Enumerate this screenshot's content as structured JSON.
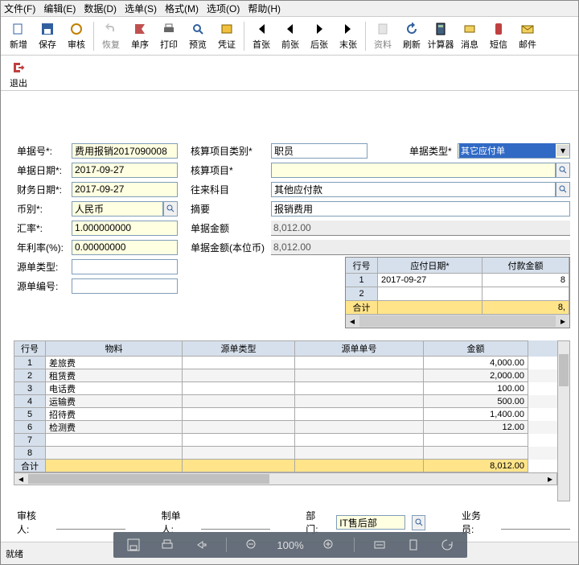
{
  "menu": {
    "file": "文件(F)",
    "edit": "编辑(E)",
    "data": "数据(D)",
    "select": "选单(S)",
    "format": "格式(M)",
    "option": "选项(O)",
    "help": "帮助(H)"
  },
  "toolbar": {
    "new": "新增",
    "save": "保存",
    "review": "审核",
    "restore": "恢复",
    "seq": "单序",
    "print": "打印",
    "preview": "预览",
    "voucher": "凭证",
    "first": "首张",
    "prev": "前张",
    "next": "后张",
    "last": "末张",
    "info": "资料",
    "refresh": "刷新",
    "calc": "计算器",
    "msg": "消息",
    "sms": "短信",
    "mail": "邮件",
    "exit": "退出"
  },
  "labels": {
    "billno": "单据号*:",
    "billdate": "单据日期*:",
    "findate": "财务日期*:",
    "curr": "币别*:",
    "rate": "汇率*:",
    "yearint": "年利率(%):",
    "srctype": "源单类型:",
    "srcno": "源单编号:",
    "acctcat": "核算项目类别*",
    "acctitem": "核算项目*",
    "fromacct": "往来科目",
    "summary": "摘要",
    "docamt": "单据金额",
    "docamtloc": "单据金额(本位币)",
    "doctype": "单据类型*"
  },
  "values": {
    "billno": "费用报销2017090008",
    "billdate": "2017-09-27",
    "findate": "2017-09-27",
    "curr": "人民币",
    "rate": "1.000000000",
    "yearint": "0.00000000",
    "srctype": "",
    "srcno": "",
    "acctcat": "职员",
    "acctitem": "",
    "fromacct": "其他应付款",
    "summary": "报销费用",
    "docamt": "8,012.00",
    "docamtloc": "8,012.00",
    "doctype": "其它应付单"
  },
  "paygrid": {
    "h_row": "行号",
    "h_date": "应付日期*",
    "h_amt": "付款金额",
    "rows": [
      {
        "n": "1",
        "date": "2017-09-27",
        "amt": "8"
      },
      {
        "n": "2",
        "date": "",
        "amt": ""
      }
    ],
    "total_lbl": "合计",
    "total_amt": "8,"
  },
  "detail": {
    "h_row": "行号",
    "h_mat": "物料",
    "h_srctype": "源单类型",
    "h_srcno": "源单单号",
    "h_amt": "金额",
    "rows": [
      {
        "n": "1",
        "mat": "差旅费",
        "srctype": "",
        "srcno": "",
        "amt": "4,000.00"
      },
      {
        "n": "2",
        "mat": "租赁费",
        "srctype": "",
        "srcno": "",
        "amt": "2,000.00"
      },
      {
        "n": "3",
        "mat": "电话费",
        "srctype": "",
        "srcno": "",
        "amt": "100.00"
      },
      {
        "n": "4",
        "mat": "运输费",
        "srctype": "",
        "srcno": "",
        "amt": "500.00"
      },
      {
        "n": "5",
        "mat": "招待费",
        "srctype": "",
        "srcno": "",
        "amt": "1,400.00"
      },
      {
        "n": "6",
        "mat": "检测费",
        "srctype": "",
        "srcno": "",
        "amt": "12.00"
      },
      {
        "n": "7",
        "mat": "",
        "srctype": "",
        "srcno": "",
        "amt": ""
      },
      {
        "n": "8",
        "mat": "",
        "srctype": "",
        "srcno": "",
        "amt": ""
      }
    ],
    "total_lbl": "合计",
    "total_amt": "8,012.00"
  },
  "footer": {
    "reviewer_lbl": "审核人:",
    "maker_lbl": "制单人:",
    "dept_lbl": "部门:",
    "sales_lbl": "业务员:",
    "dept_val": "IT售后部"
  },
  "status": {
    "ready": "就绪"
  },
  "floatbar": {
    "zoom": "100%"
  }
}
